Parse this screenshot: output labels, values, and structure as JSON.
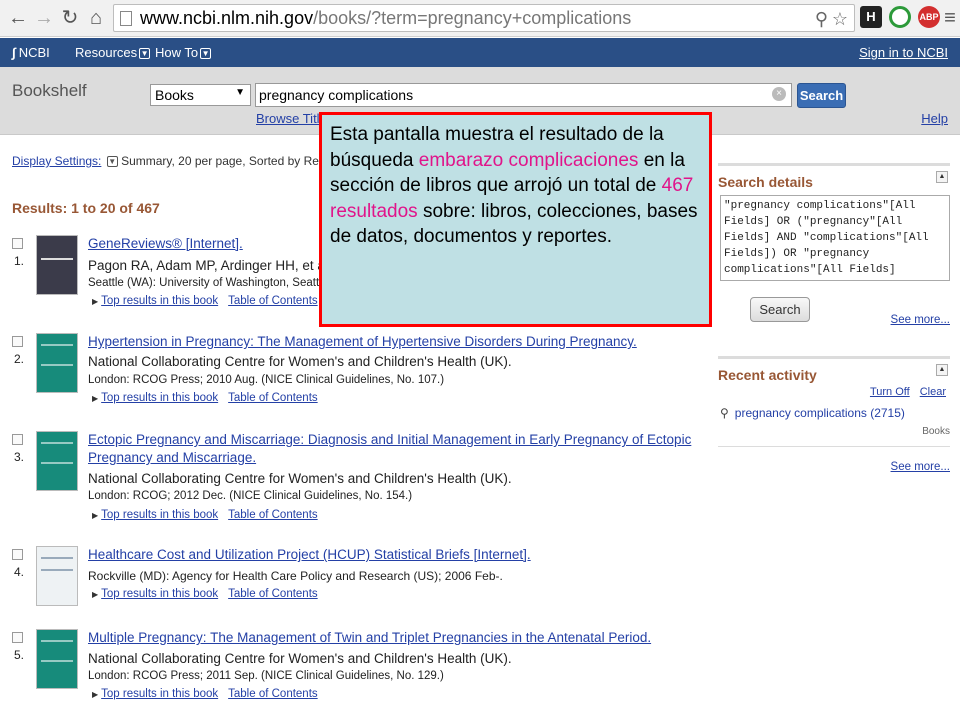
{
  "browser": {
    "url_host": "www.ncbi.nlm.nih.gov",
    "url_rest": "/books/?term=pregnancy+complications"
  },
  "ncbi": {
    "logo": "NCBI",
    "resources": "Resources",
    "howto": "How To",
    "signin": "Sign in to NCBI"
  },
  "search": {
    "section_title": "Bookshelf",
    "database": "Books",
    "query": "pregnancy complications",
    "button": "Search",
    "browse": "Browse Title",
    "help": "Help"
  },
  "display": {
    "label": "Display Settings:",
    "summary": "Summary, 20 per page, Sorted by Rele"
  },
  "results_count": "Results: 1 to 20 of 467",
  "results": [
    {
      "num": "1.",
      "title": "GeneReviews® [Internet].",
      "authors": "Pagon RA, Adam MP, Ardinger HH, et al.,",
      "source": "Seattle (WA): University of Washington, Seattle; 19",
      "link1": "Top results in this book",
      "link2": "Table of Contents"
    },
    {
      "num": "2.",
      "title": "Hypertension in Pregnancy: The Management of Hypertensive Disorders During Pregnancy.",
      "authors": "National Collaborating Centre for Women's and Children's Health (UK).",
      "source": "London: RCOG Press; 2010 Aug. (NICE Clinical Guidelines, No. 107.)",
      "link1": "Top results in this book",
      "link2": "Table of Contents"
    },
    {
      "num": "3.",
      "title": "Ectopic Pregnancy and Miscarriage: Diagnosis and Initial Management in Early Pregnancy of Ectopic Pregnancy and Miscarriage.",
      "authors": "National Collaborating Centre for Women's and Children's Health (UK).",
      "source": "London: RCOG; 2012 Dec. (NICE Clinical Guidelines, No. 154.)",
      "link1": "Top results in this book",
      "link2": "Table of Contents"
    },
    {
      "num": "4.",
      "title": "Healthcare Cost and Utilization Project (HCUP) Statistical Briefs [Internet].",
      "authors": "",
      "source": "Rockville (MD): Agency for Health Care Policy and Research (US); 2006 Feb-.",
      "link1": "Top results in this book",
      "link2": "Table of Contents"
    },
    {
      "num": "5.",
      "title": "Multiple Pregnancy: The Management of Twin and Triplet Pregnancies in the Antenatal Period.",
      "authors": "National Collaborating Centre for Women's and Children's Health (UK).",
      "source": "London: RCOG Press; 2011 Sep. (NICE Clinical Guidelines, No. 129.)",
      "link1": "Top results in this book",
      "link2": "Table of Contents"
    }
  ],
  "sidebar": {
    "details_title": "Search details",
    "details_text": "\"pregnancy complications\"[All Fields] OR (\"pregnancy\"[All Fields] AND \"complications\"[All Fields]) OR \"pregnancy complications\"[All Fields]",
    "search_button": "Search",
    "see_more": "See more...",
    "recent_title": "Recent activity",
    "turn_off": "Turn Off",
    "clear": "Clear",
    "recent_query": "pregnancy complications (2715)",
    "recent_db": "Books",
    "see_more2": "See more..."
  },
  "callout": {
    "p1": "Esta pantalla muestra el resultado de la búsqueda ",
    "h1": "embarazo complicaciones",
    "p2": " en la sección de libros que arrojó un total de ",
    "h2": "467 resultados",
    "p3": " sobre: libros, colecciones, bases de datos, documentos y reportes."
  },
  "colors": {
    "ncbi_header": "#2a4f86",
    "link": "#2440a6",
    "heading_brown": "#985735",
    "callout_bg": "#bfe0e4",
    "callout_border": "#ff0000",
    "highlight": "#e0148a"
  }
}
